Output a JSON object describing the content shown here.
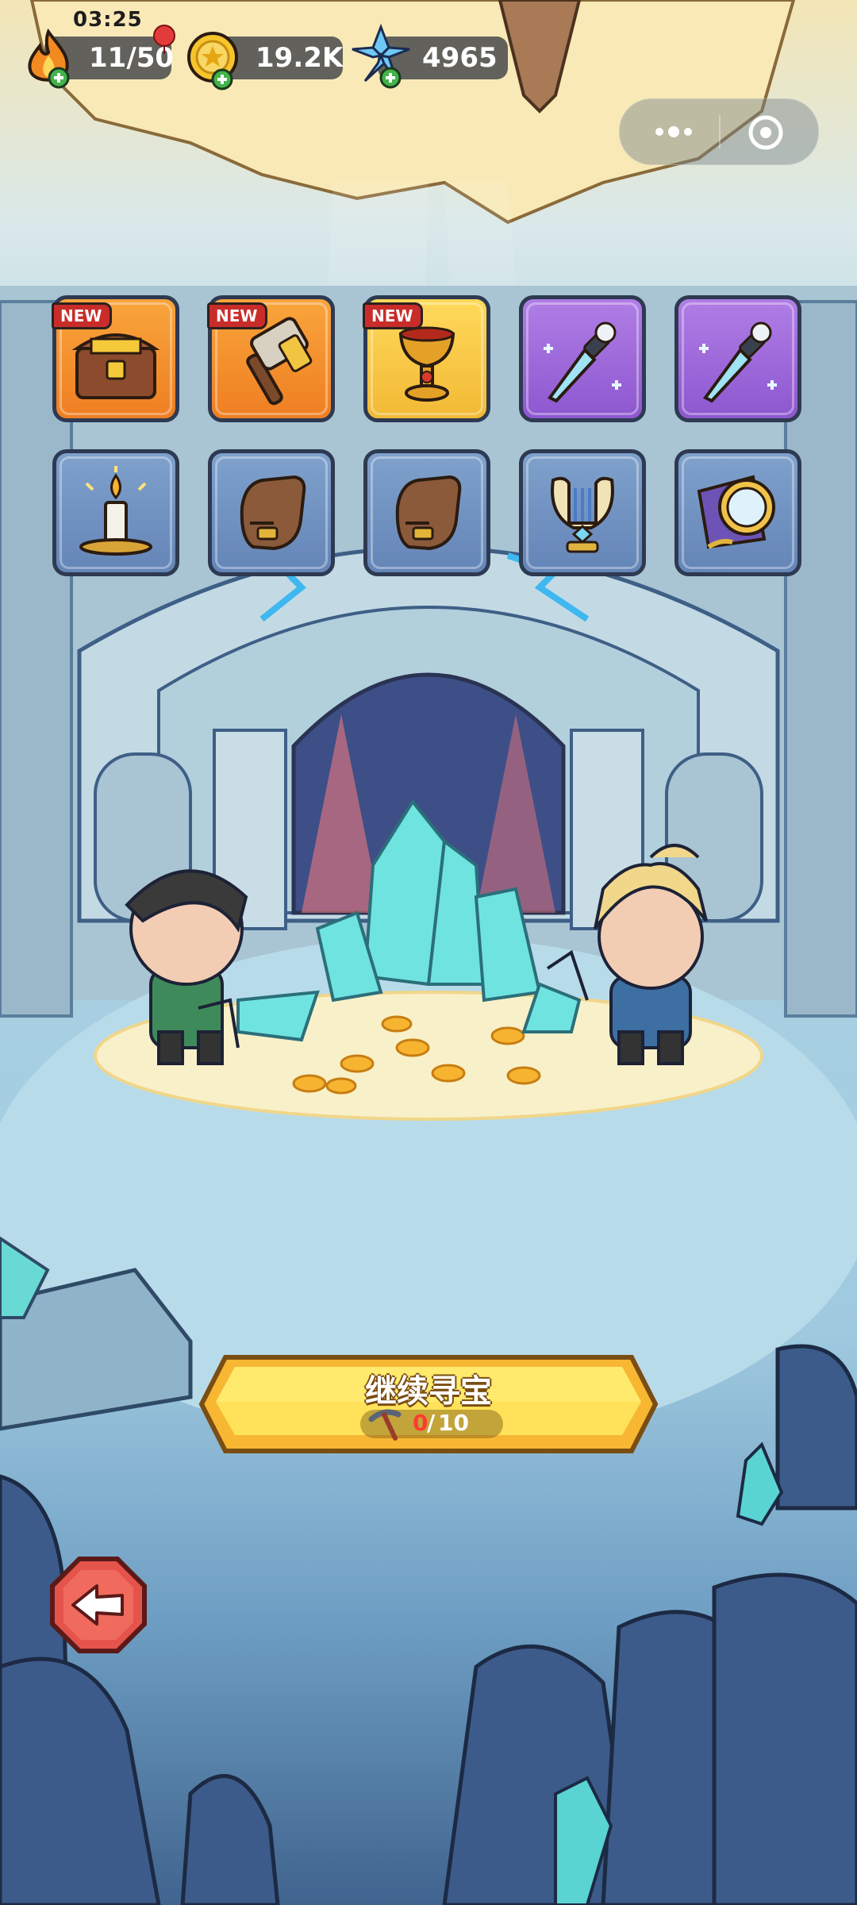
{
  "status_bar": {
    "time": "03:25"
  },
  "resources": {
    "stamina": {
      "value": "11/50",
      "icon": "flame-icon"
    },
    "gold": {
      "value": "19.2K",
      "icon": "gold-coin-icon"
    },
    "crystals": {
      "value": "4965",
      "icon": "blue-crystal-icon"
    }
  },
  "mini_program_capsule": {
    "more_icon": "more-dots-icon",
    "close_icon": "target-close-icon"
  },
  "rewards": {
    "new_label": "NEW",
    "row1": [
      {
        "item": "treasure-chest",
        "rarity": "orange",
        "is_new": true
      },
      {
        "item": "war-hammer",
        "rarity": "orange",
        "is_new": true
      },
      {
        "item": "golden-chalice",
        "rarity": "yellow",
        "is_new": true
      },
      {
        "item": "frost-dagger",
        "rarity": "purple",
        "is_new": false
      },
      {
        "item": "frost-dagger",
        "rarity": "purple",
        "is_new": false
      }
    ],
    "row2": [
      {
        "item": "candle",
        "rarity": "blue"
      },
      {
        "item": "leather-glove",
        "rarity": "blue"
      },
      {
        "item": "leather-glove",
        "rarity": "blue"
      },
      {
        "item": "golden-lyre",
        "rarity": "blue"
      },
      {
        "item": "magic-mirror",
        "rarity": "blue"
      }
    ]
  },
  "action": {
    "label": "继续寻宝",
    "pickaxe_current": "0",
    "separator": "/",
    "pickaxe_max": "10"
  },
  "colors": {
    "accent_yellow": "#ffd84a",
    "counter_red": "#ff3b2f",
    "purple_rarity": "#9a63d8",
    "orange_rarity": "#f5922e"
  }
}
